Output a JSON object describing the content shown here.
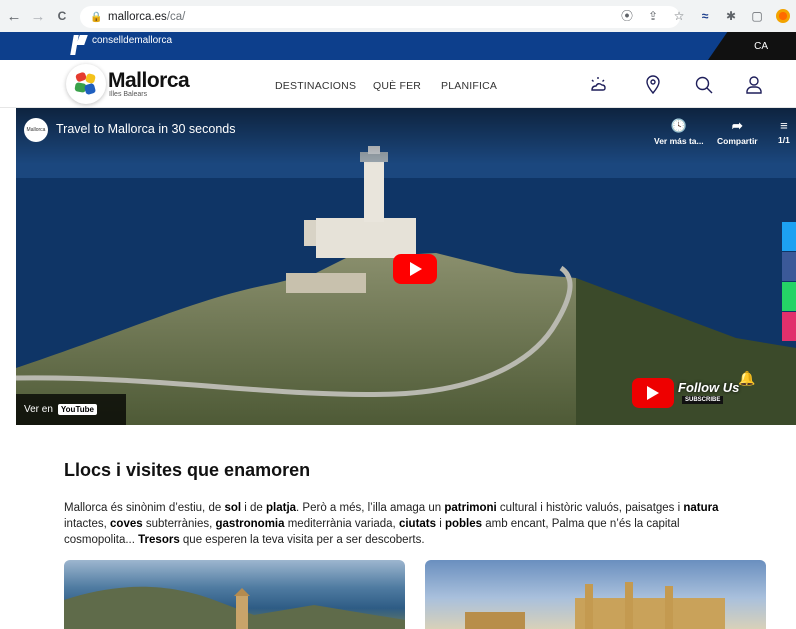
{
  "browser": {
    "back": "←",
    "forward": "→",
    "reload": "C",
    "url_host": "mallorca.es",
    "url_path": "/ca/"
  },
  "topbar": {
    "org_name": "conselldemallorca",
    "language": "CA",
    "color": "#0d3f8c"
  },
  "header": {
    "brand_name": "Mallorca",
    "brand_sub": "Illes Balears",
    "nav": [
      "DESTINACIONS",
      "QUÈ FER",
      "PLANIFICA"
    ],
    "icons": [
      "weather-icon",
      "location-pin-icon",
      "search-icon",
      "user-icon"
    ]
  },
  "video": {
    "channel": "Mallorca",
    "title": "Travel to Mallorca in 30 seconds",
    "watch_later": "Ver más ta...",
    "share": "Compartir",
    "playlist": "1/1",
    "watch_on": "Ver en",
    "youtube": "YouTube",
    "follow": "Follow Us",
    "subscribe": "SUBSCRIBE"
  },
  "share_rail": {
    "colors": [
      "#1da1f2",
      "#3b5998",
      "#25d366",
      "#e1306c"
    ]
  },
  "content": {
    "title": "Llocs i visites que enamoren",
    "p": [
      "Mallorca és sinònim d’estiu, de ",
      "sol",
      " i de ",
      "platja",
      ". Però a més, l’illa amaga un ",
      "patrimoni",
      " cultural i històric valuós, paisatges i ",
      "natura",
      " intactes, ",
      "coves",
      " subterrànies, ",
      "gastronomia",
      " mediterrània variada, ",
      "ciutats",
      " i ",
      "pobles",
      " amb encant, Palma que n’és la capital cosmopolita... ",
      "Tresors",
      " que esperen la teva visita per a ser descoberts."
    ]
  }
}
